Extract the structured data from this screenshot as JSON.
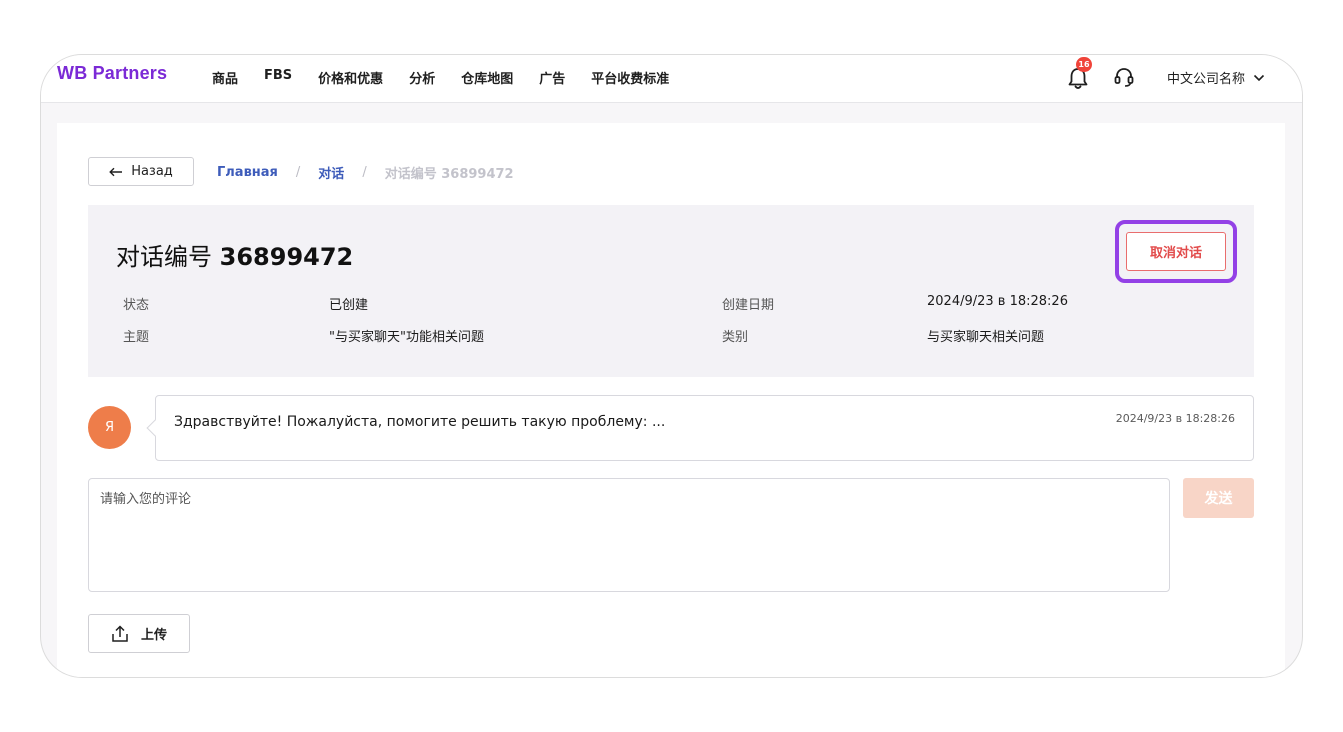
{
  "brand": {
    "logo": "WB Partners",
    "color": "#7b2ad6"
  },
  "nav": {
    "items": [
      "商品",
      "FBS",
      "价格和优惠",
      "分析",
      "仓库地图",
      "广告",
      "平台收费标准"
    ],
    "notifications_count": "16",
    "account_name": "中文公司名称",
    "icons": [
      "bell-icon",
      "headset-icon",
      "chevron-down-icon"
    ]
  },
  "breadcrumb": {
    "back_label": "Назад",
    "items": [
      "Главная",
      "对话",
      "对话编号 36899472"
    ],
    "separator": "/"
  },
  "dialog": {
    "title_prefix": "对话编号",
    "title_number": "36899472",
    "cancel_label": "取消对话",
    "fields": {
      "status_label": "状态",
      "status_value": "已创建",
      "topic_label": "主题",
      "topic_value": "\"与买家聊天\"功能相关问题",
      "created_label": "创建日期",
      "created_value": "2024/9/23 в 18:28:26",
      "category_label": "类别",
      "category_value": "与买家聊天相关问题"
    }
  },
  "message": {
    "avatar_initial": "Я",
    "text": "Здравствуйте! Пожалуйста, помогите решить такую проблему: ...",
    "time": "2024/9/23 в 18:28:26"
  },
  "composer": {
    "placeholder": "请输入您的评论",
    "send_label": "发送",
    "upload_label": "上传"
  },
  "colors": {
    "accent_purple": "#9341e6",
    "danger": "#e24b4b",
    "send_disabled": "#f8d5c7",
    "avatar": "#ee7d4a"
  }
}
